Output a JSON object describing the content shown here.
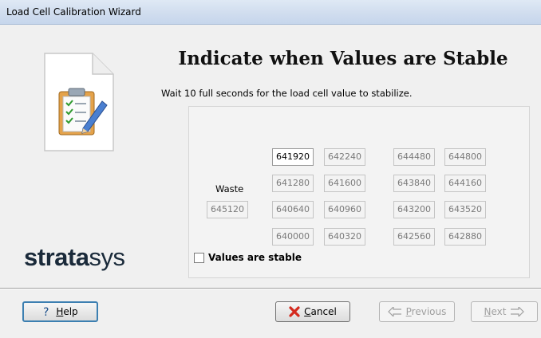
{
  "window": {
    "title": "Load Cell Calibration Wizard"
  },
  "sidebar": {
    "logo_bold": "strata",
    "logo_light": "sys"
  },
  "main": {
    "heading": "Indicate when Values are Stable",
    "instruction": "Wait 10 full seconds for the load cell value to stabilize.",
    "waste_label": "Waste",
    "waste_value": "645120",
    "grid": [
      [
        "641920",
        "642240",
        "644480",
        "644800"
      ],
      [
        "641280",
        "641600",
        "643840",
        "644160"
      ],
      [
        "640640",
        "640960",
        "643200",
        "643520"
      ],
      [
        "640000",
        "640320",
        "642560",
        "642880"
      ]
    ],
    "active_cell": "641920",
    "checkbox": {
      "label": "Values are stable",
      "checked": false
    }
  },
  "buttons": {
    "help": {
      "accel": "H",
      "rest": "elp"
    },
    "cancel": {
      "accel": "C",
      "rest": "ancel"
    },
    "previous": {
      "accel": "P",
      "rest": "revious",
      "enabled": false
    },
    "next": {
      "accel": "N",
      "rest": "ext",
      "enabled": false
    }
  },
  "icons": {
    "document": "checklist-document-icon",
    "help": "question-mark-icon",
    "cancel": "red-x-icon",
    "previous": "arrow-left-icon",
    "next": "arrow-right-icon"
  },
  "colors": {
    "cancel_x": "#d42a1e",
    "logo": "#1a2a3a",
    "help_border": "#3c7fb1"
  }
}
